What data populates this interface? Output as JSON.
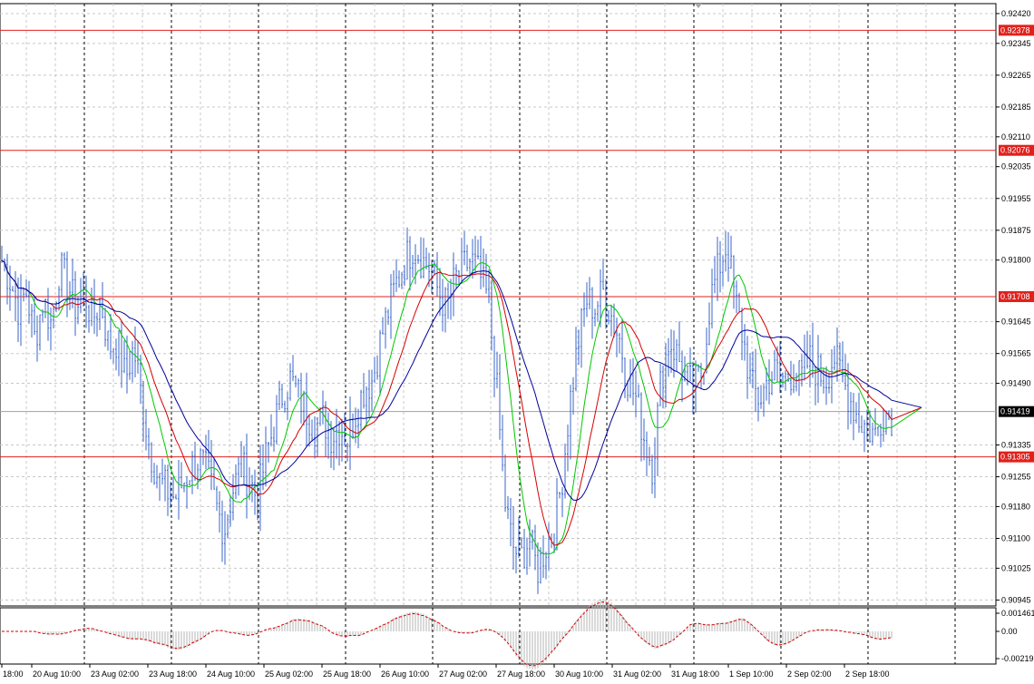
{
  "chart_data": {
    "type": "candlestick",
    "symbol_hint": "",
    "main_panel": {
      "y_axis_ticks": [
        "0.92420",
        "0.92345",
        "0.92265",
        "0.92185",
        "0.92110",
        "0.92035",
        "0.91955",
        "0.91875",
        "0.91800",
        "0.91645",
        "0.91565",
        "0.91490",
        "0.91335",
        "0.91255",
        "0.91180",
        "0.91100",
        "0.91025",
        "0.90945"
      ],
      "ylim": [
        0.90945,
        0.9244
      ],
      "horizontal_levels": [
        {
          "label": "0.92378",
          "value": 0.92378,
          "color": "#e0211c"
        },
        {
          "label": "0.92076",
          "value": 0.92076,
          "color": "#e0211c"
        },
        {
          "label": "0.91708",
          "value": 0.91708,
          "color": "#e0211c"
        },
        {
          "label": "0.91305",
          "value": 0.91305,
          "color": "#e0211c"
        }
      ],
      "current_price": {
        "label": "0.91419",
        "value": 0.91419
      },
      "price_series": [
        0.918,
        0.9175,
        0.9168,
        0.9172,
        0.916,
        0.917,
        0.9164,
        0.9178,
        0.9174,
        0.9168,
        0.9172,
        0.9165,
        0.917,
        0.9158,
        0.916,
        0.915,
        0.9158,
        0.9145,
        0.9132,
        0.9125,
        0.9122,
        0.912,
        0.9124,
        0.9128,
        0.913,
        0.9126,
        0.9118,
        0.9112,
        0.9122,
        0.9128,
        0.9125,
        0.912,
        0.913,
        0.9138,
        0.9146,
        0.915,
        0.9146,
        0.9142,
        0.9138,
        0.914,
        0.9136,
        0.9138,
        0.9135,
        0.9142,
        0.9148,
        0.915,
        0.916,
        0.9168,
        0.9175,
        0.918,
        0.9184,
        0.918,
        0.9178,
        0.9172,
        0.9168,
        0.9175,
        0.9178,
        0.918,
        0.9176,
        0.917,
        0.915,
        0.912,
        0.9108,
        0.9105,
        0.911,
        0.9102,
        0.9108,
        0.9112,
        0.9125,
        0.9145,
        0.916,
        0.917,
        0.9168,
        0.9172,
        0.9166,
        0.916,
        0.915,
        0.9145,
        0.9135,
        0.9128,
        0.915,
        0.916,
        0.9156,
        0.915,
        0.9148,
        0.9152,
        0.917,
        0.9178,
        0.9184,
        0.917,
        0.916,
        0.9148,
        0.9145,
        0.915,
        0.9152,
        0.915,
        0.9152,
        0.915,
        0.9155,
        0.9152,
        0.915,
        0.9156,
        0.915,
        0.9145,
        0.914,
        0.9138,
        0.9136,
        0.9142,
        0.9141
      ],
      "moving_averages": [
        {
          "color": "#00c800"
        },
        {
          "color": "#d40000"
        },
        {
          "color": "#00009c"
        }
      ]
    },
    "indicator_panel": {
      "y_axis_ticks": [
        "0.001461",
        "0.00",
        "-0.00219"
      ],
      "ylim": [
        -0.00219,
        0.001461
      ]
    },
    "x_axis_ticks": [
      "18:00",
      "20 Aug 10:00",
      "23 Aug 02:00",
      "23 Aug 18:00",
      "24 Aug 10:00",
      "25 Aug 02:00",
      "25 Aug 18:00",
      "26 Aug 10:00",
      "27 Aug 02:00",
      "27 Aug 18:00",
      "30 Aug 10:00",
      "31 Aug 02:00",
      "31 Aug 18:00",
      "1 Sep 10:00",
      "2 Sep 02:00",
      "2 Sep 18:00"
    ],
    "grid": true,
    "colors": {
      "bars": "#3a64c8",
      "level_line": "#e0211c",
      "grid": "#c8c8c8",
      "macd_line": "#d40000",
      "histogram": "#b4b4b4",
      "tag_bg_level": "#e0211c",
      "tag_bg_current": "#000000"
    }
  }
}
